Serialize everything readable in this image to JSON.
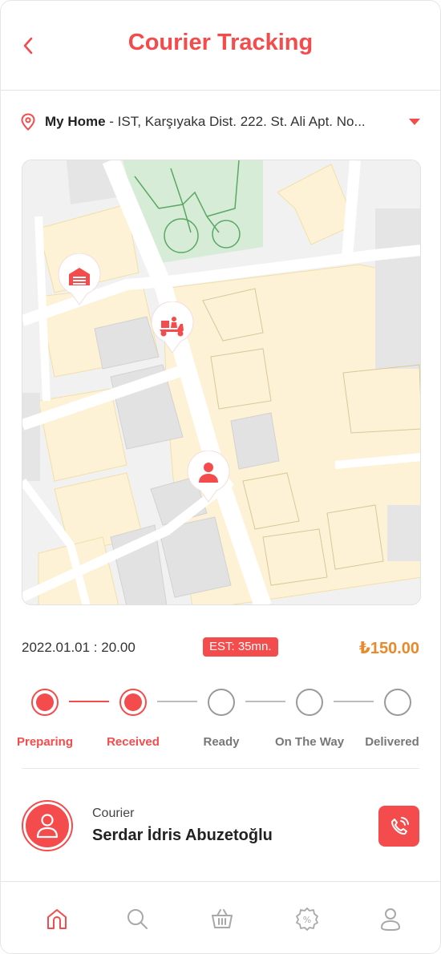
{
  "header": {
    "title": "Courier Tracking"
  },
  "address": {
    "name": "My Home",
    "detail": " - IST, Karşıyaka Dist. 222. St. Ali Apt. No..."
  },
  "order": {
    "date": "2022.01.01 : 20.00",
    "est": "EST: 35mn.",
    "price": "₺150.00"
  },
  "steps": [
    {
      "label": "Preparing",
      "state": "active"
    },
    {
      "label": "Received",
      "state": "active"
    },
    {
      "label": "Ready",
      "state": "inactive"
    },
    {
      "label": "On The Way",
      "state": "inactive"
    },
    {
      "label": "Delivered",
      "state": "inactive"
    }
  ],
  "courier": {
    "role": "Courier",
    "name": "Serdar İdris Abuzetoğlu"
  },
  "tabs": [
    {
      "icon": "home-icon",
      "active": true
    },
    {
      "icon": "search-icon",
      "active": false
    },
    {
      "icon": "basket-icon",
      "active": false
    },
    {
      "icon": "discount-icon",
      "active": false
    },
    {
      "icon": "profile-icon",
      "active": false
    }
  ],
  "colors": {
    "accent": "#f44c4c",
    "price": "#e88a2c",
    "park": "#d6ecd6",
    "building": "#fdf2d6",
    "road": "#ffffff",
    "block": "#e5e5e5"
  }
}
